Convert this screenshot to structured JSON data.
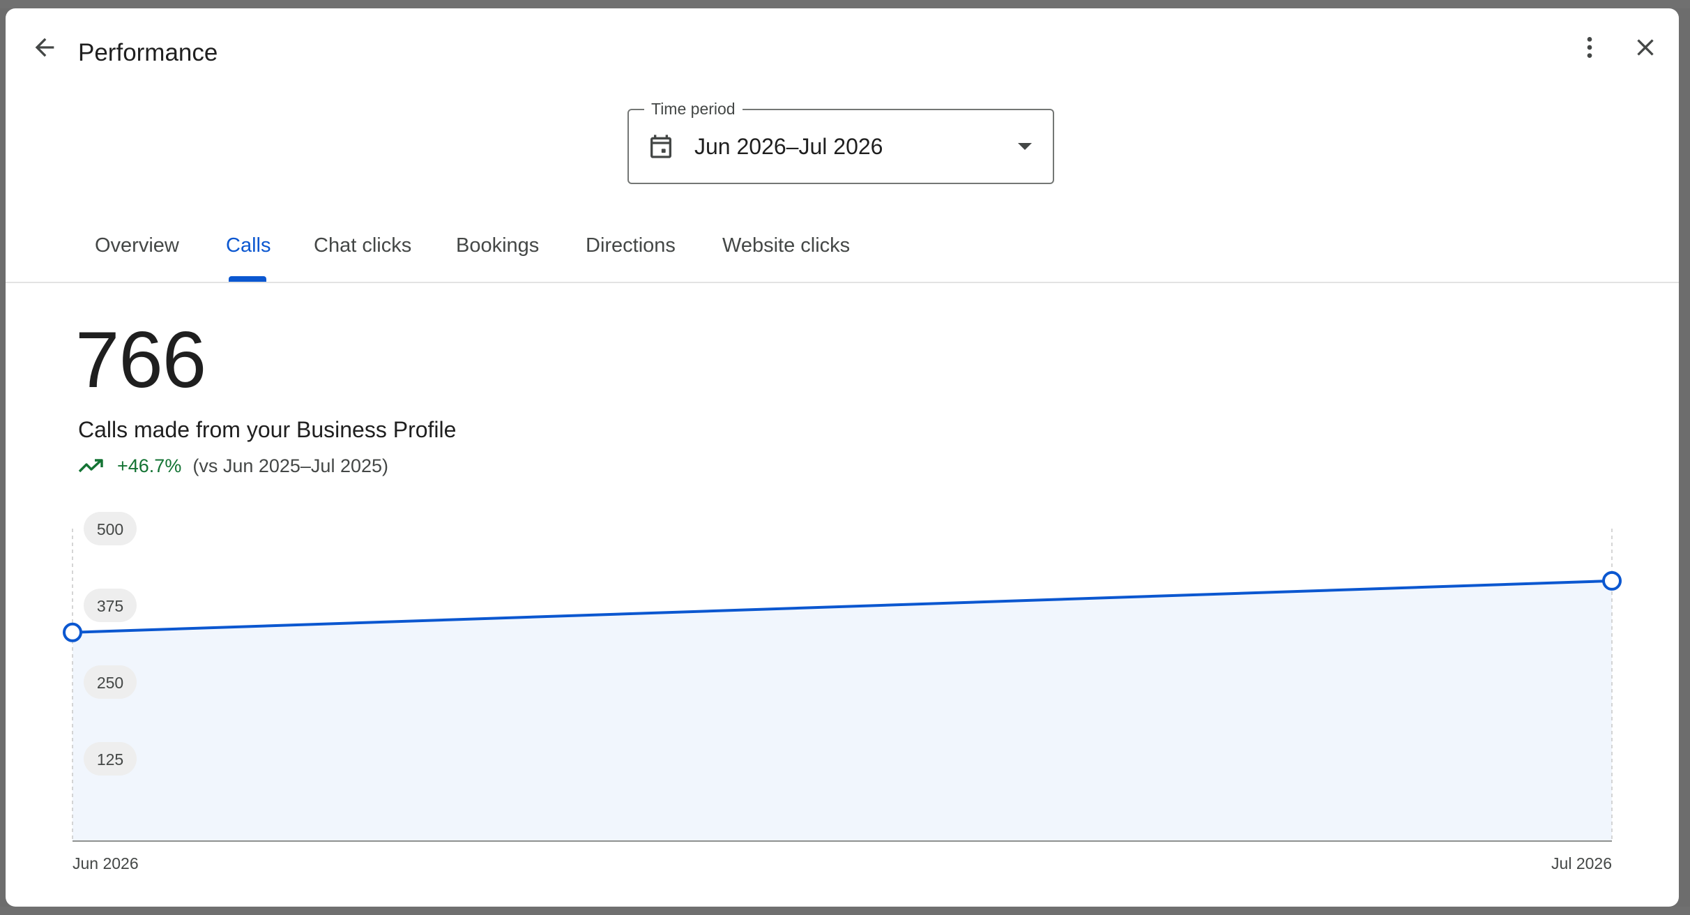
{
  "header": {
    "title": "Performance"
  },
  "period": {
    "label": "Time period",
    "value": "Jun 2026–Jul 2026"
  },
  "tabs": [
    {
      "label": "Overview",
      "active": false
    },
    {
      "label": "Calls",
      "active": true
    },
    {
      "label": "Chat clicks",
      "active": false
    },
    {
      "label": "Bookings",
      "active": false
    },
    {
      "label": "Directions",
      "active": false
    },
    {
      "label": "Website clicks",
      "active": false
    }
  ],
  "metric": {
    "value": "766",
    "caption": "Calls made from your Business Profile",
    "change": "+46.7%",
    "comparison": "(vs Jun 2025–Jul 2025)"
  },
  "colors": {
    "accent": "#0b57d0",
    "positive": "#137333",
    "area_fill": "#f1f6fd"
  },
  "chart_data": {
    "type": "area",
    "x": [
      "Jun 2026",
      "Jul 2026"
    ],
    "values": [
      340,
      424
    ],
    "ylim": [
      0,
      500
    ],
    "yticks": [
      125,
      250,
      375,
      500
    ],
    "grid": false
  }
}
